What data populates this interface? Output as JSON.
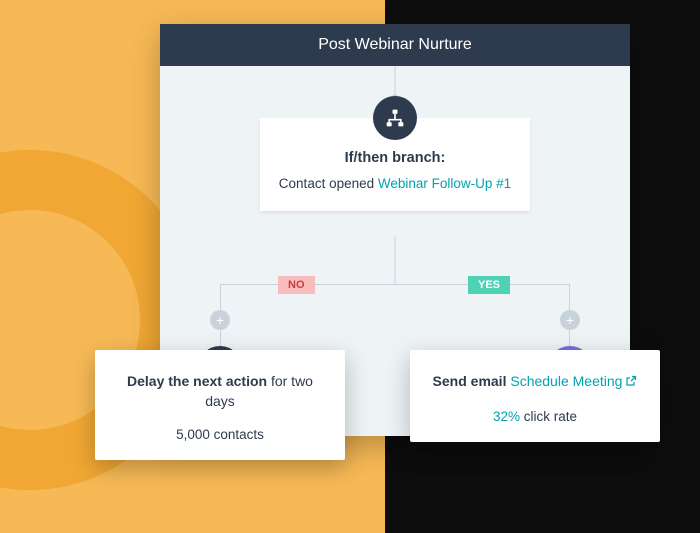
{
  "panel": {
    "title": "Post Webinar Nurture"
  },
  "branch": {
    "title": "If/then branch:",
    "desc_prefix": "Contact opened ",
    "desc_link": "Webinar Follow-Up #1"
  },
  "badges": {
    "no": "NO",
    "yes": "YES"
  },
  "add_symbol": "+",
  "left_card": {
    "bold": "Delay the next action",
    "rest": " for two days",
    "sub": "5,000 contacts"
  },
  "right_card": {
    "bold": "Send email ",
    "link": "Schedule Meeting",
    "metric": "32%",
    "sub_rest": " click rate"
  }
}
